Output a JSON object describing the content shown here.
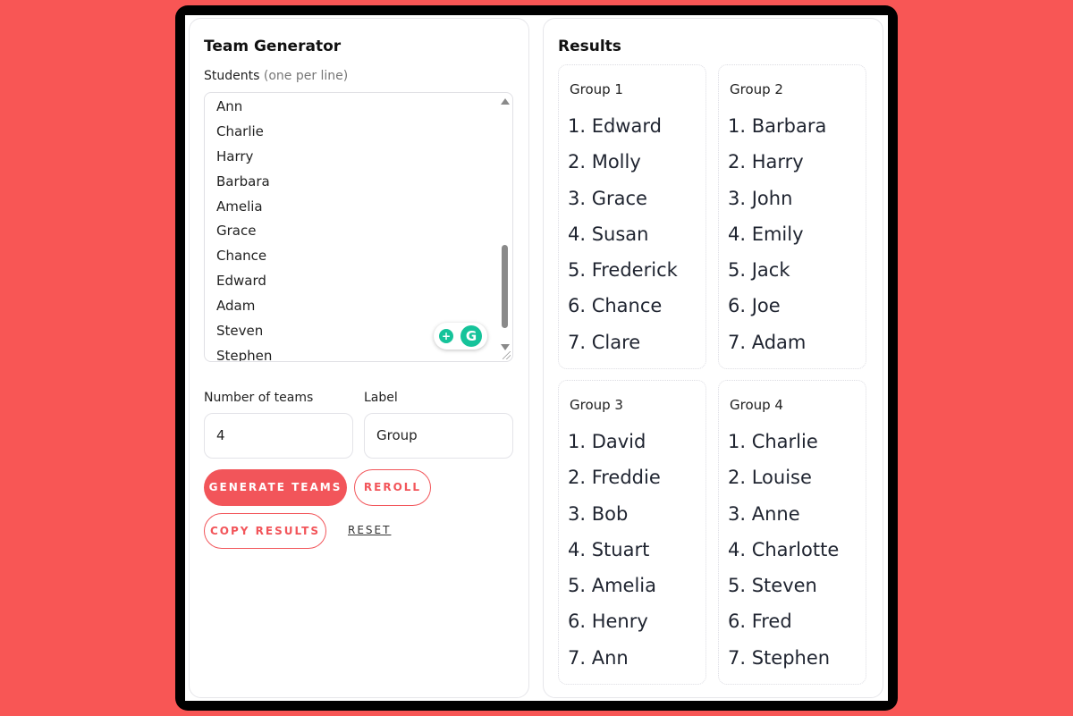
{
  "app": {
    "title": "Team Generator"
  },
  "students": {
    "label": "Students",
    "hint": "(one per line)",
    "lines": [
      "Ann",
      "Charlie",
      "Harry",
      "Barbara",
      "Amelia",
      "Grace",
      "Chance",
      "Edward",
      "Adam",
      "Steven",
      "Stephen"
    ]
  },
  "fields": {
    "teams_label": "Number of teams",
    "teams_value": "4",
    "label_label": "Label",
    "label_value": "Group"
  },
  "buttons": {
    "generate": "GENERATE TEAMS",
    "reroll": "REROLL",
    "copy": "COPY RESULTS",
    "reset": "RESET"
  },
  "results": {
    "title": "Results",
    "groups": [
      {
        "name": "Group 1",
        "members": [
          "1. Edward",
          "2. Molly",
          "3. Grace",
          "4. Susan",
          "5. Frederick",
          "6. Chance",
          "7. Clare"
        ]
      },
      {
        "name": "Group 2",
        "members": [
          "1. Barbara",
          "2. Harry",
          "3. John",
          "4. Emily",
          "5. Jack",
          "6. Joe",
          "7. Adam"
        ]
      },
      {
        "name": "Group 3",
        "members": [
          "1. David",
          "2. Freddie",
          "3. Bob",
          "4. Stuart",
          "5. Amelia",
          "6. Henry",
          "7. Ann"
        ]
      },
      {
        "name": "Group 4",
        "members": [
          "1. Charlie",
          "2. Louise",
          "3. Anne",
          "4. Charlotte",
          "5. Steven",
          "6. Fred",
          "7. Stephen"
        ]
      }
    ]
  },
  "colors": {
    "background": "#f85655",
    "accent": "#f2555a",
    "grammarly": "#15c39a"
  },
  "icons": {
    "grammarly_bulb": "lightbulb-icon",
    "grammarly_logo": "grammarly-icon"
  }
}
